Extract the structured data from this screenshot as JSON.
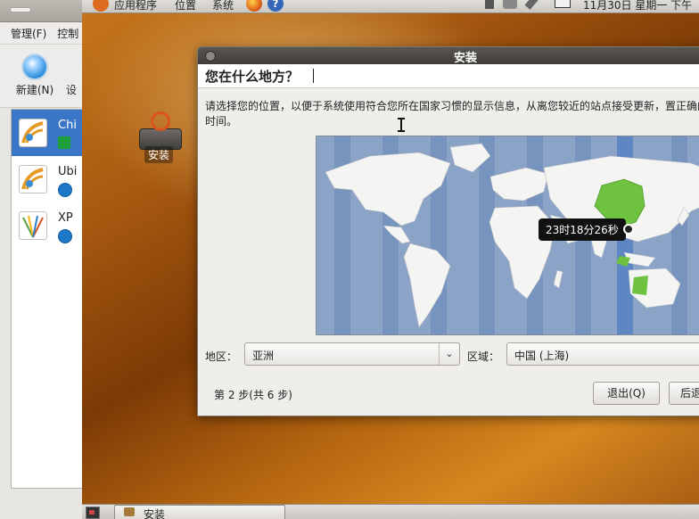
{
  "host": {
    "menu": [
      "管理(F)",
      "控制"
    ],
    "toolbar": {
      "new_label": "新建(N)",
      "settings_partial": "设"
    },
    "vm_list": [
      {
        "name": "Chi",
        "state": "running",
        "selected": true
      },
      {
        "name": "Ubi",
        "state": "powered-off",
        "selected": false
      },
      {
        "name": "XP",
        "state": "powered-off",
        "selected": false
      }
    ]
  },
  "guest_panel": {
    "apps_menu": "应用程序",
    "places_menu": "位置",
    "system_menu": "系统",
    "clock": "11月30日 星期一 下午"
  },
  "desktop_icon": {
    "label": "安装"
  },
  "installer": {
    "window_title": "安装",
    "heading": "您在什么地方？",
    "instructions": "请选择您的位置，以便于系统使用符合您所在国家习惯的显示信息，从离您较近的站点接受更新，置正确的本地时间。",
    "map": {
      "time_tooltip": "23时18分26秒",
      "highlighted_region": "China"
    },
    "region_label": "地区：",
    "region_value": "亚洲",
    "zone_label": "区域：",
    "zone_value": "中国 (上海)",
    "step_text": "第 2 步(共 6 步)",
    "quit_button": "退出(Q)",
    "back_button": "后退"
  },
  "taskbar": {
    "window_button": "安装"
  },
  "colors": {
    "desktop_orange": "#b3640f",
    "selection_blue": "#3a77c8",
    "map_ocean": "#8aa3c6",
    "land": "#f4f4f2",
    "selected_country": "#6ec240",
    "tooltip_bg": "#111111"
  }
}
